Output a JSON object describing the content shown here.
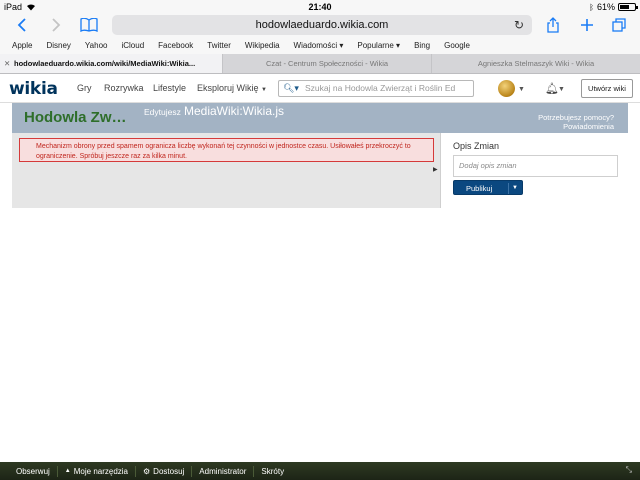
{
  "status": {
    "device": "iPad",
    "time": "21:40",
    "battery": "61%",
    "battery_level": 0.61
  },
  "toolbar": {
    "url": "hodowlaeduardo.wikia.com"
  },
  "bookmarks": [
    "Apple",
    "Disney",
    "Yahoo",
    "iCloud",
    "Facebook",
    "Twitter",
    "Wikipedia",
    "Wiadomości ▾",
    "Popularne ▾",
    "Bing",
    "Google"
  ],
  "tabs": [
    {
      "title": "hodowlaeduardo.wikia.com/wiki/MediaWiki:Wikia...",
      "active": true
    },
    {
      "title": "Czat - Centrum Społeczności - Wikia",
      "active": false
    },
    {
      "title": "Agnieszka Stelmaszyk Wiki - Wikia",
      "active": false
    }
  ],
  "wikia": {
    "logo": "wikia",
    "nav": [
      "Gry",
      "Rozrywka",
      "Lifestyle",
      "Eksploruj Wikię"
    ],
    "search_placeholder": "Szukaj na Hodowla Zwierząt i Roślin Ed",
    "create_label": "Utwórz wiki"
  },
  "header": {
    "wiki_name": "Hodowla Zw…",
    "edit_prefix": "Edytujesz",
    "edit_title": "MediaWiki:Wikia.js",
    "help_line1": "Potrzebujesz pomocy?",
    "help_line2": "Powiadomienia"
  },
  "error": {
    "message": "Mechanizm obrony przed spamem ogranicza liczbę wykonań tej czynności w jednostce czasu. Usiłowałeś przekroczyć to ograniczenie. Spróbuj jeszcze raz za kilka minut."
  },
  "side": {
    "title": "Opis Zmian",
    "summary_placeholder": "Dodaj opis zmian",
    "publish_label": "Publikuj"
  },
  "bottom": [
    "Obserwuj",
    "Moje narzędzia",
    "Dostosuj",
    "Administrator",
    "Skróty"
  ]
}
